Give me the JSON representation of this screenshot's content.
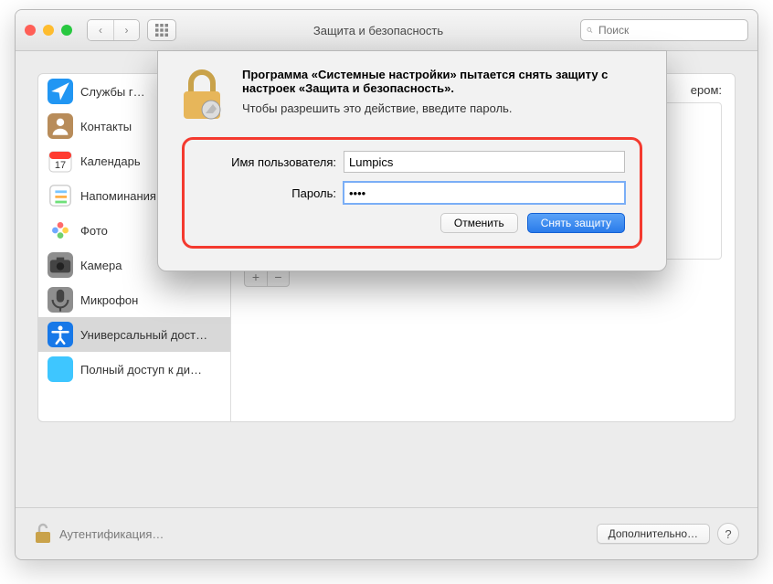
{
  "window": {
    "title": "Защита и безопасность"
  },
  "search": {
    "placeholder": "Поиск"
  },
  "sidebar": {
    "items": [
      {
        "label": "Службы г…",
        "icon": "location",
        "color": "#2196f3"
      },
      {
        "label": "Контакты",
        "icon": "contacts",
        "color": "#b88c5a"
      },
      {
        "label": "Календарь",
        "icon": "calendar",
        "color": "#ffffff"
      },
      {
        "label": "Напоминания",
        "icon": "reminders",
        "color": "#ffffff"
      },
      {
        "label": "Фото",
        "icon": "photos",
        "color": "#ffffff"
      },
      {
        "label": "Камера",
        "icon": "camera",
        "color": "#8e8e8e"
      },
      {
        "label": "Микрофон",
        "icon": "microphone",
        "color": "#8e8e8e"
      },
      {
        "label": "Универсальный дост…",
        "icon": "accessibility",
        "color": "#1778e8",
        "selected": true
      },
      {
        "label": "Полный доступ к ди…",
        "icon": "folder",
        "color": "#3ec6ff"
      }
    ]
  },
  "main": {
    "hdr_suffix": "ером:"
  },
  "auth": {
    "heading": "Программа «Системные настройки» пытается снять защиту с настроек «Защита и безопасность».",
    "sub": "Чтобы разрешить это действие, введите пароль.",
    "user_label": "Имя пользователя:",
    "pass_label": "Пароль:",
    "user_value": "Lumpics",
    "pass_value": "••••",
    "cancel": "Отменить",
    "ok": "Снять защиту"
  },
  "footer": {
    "lock_text": "Аутентификация…",
    "advanced": "Дополнительно…"
  },
  "buttons": {
    "plus": "+",
    "minus": "−",
    "help": "?"
  }
}
